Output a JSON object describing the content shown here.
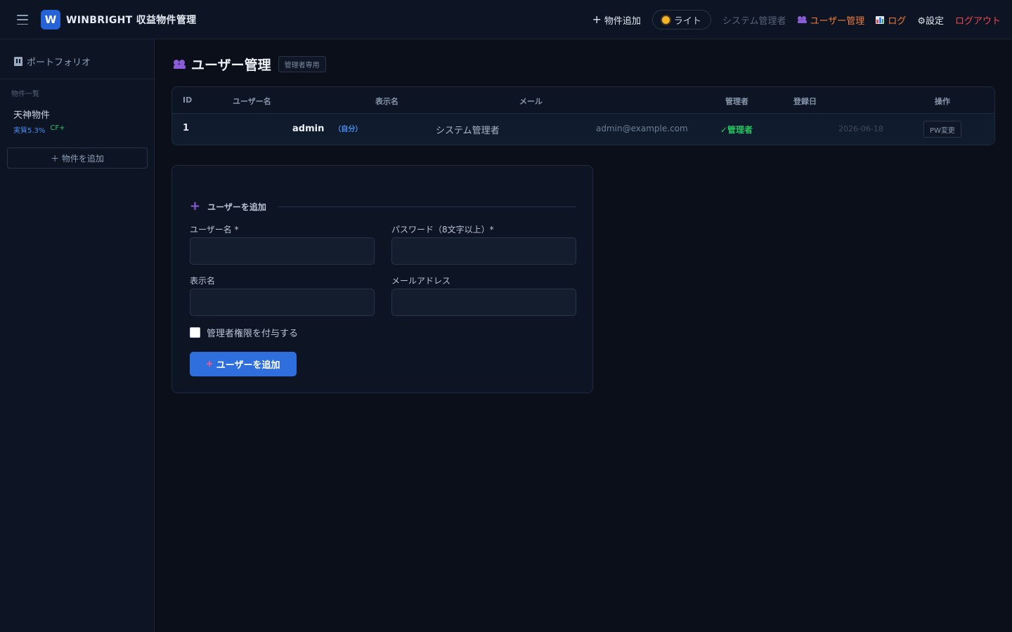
{
  "header": {
    "logo_letter": "W",
    "app_title": "WINBRIGHT 収益物件管理",
    "add_property": "物件追加",
    "add_property_icon": "plus-icon",
    "theme_label": "ライト",
    "theme_icon": "sun-icon",
    "current_user": "システム管理者",
    "user_management": "ユーザー管理",
    "logs": "ログ",
    "settings": "⚙設定",
    "logout": "ログアウト",
    "colors": {
      "accent": "#2563d6",
      "orange": "#f07d3a",
      "logout": "#f0474f"
    }
  },
  "sidebar": {
    "portfolio": "ポートフォリオ",
    "section_title": "物件一覧",
    "properties": [
      {
        "name": "天神物件",
        "yield": "実質5.3%",
        "cf": "CF+"
      }
    ],
    "add_button": "＋ 物件を追加"
  },
  "main": {
    "title": "ユーザー管理",
    "badge": "管理者専用",
    "table": {
      "columns": [
        "ID",
        "ユーザー名",
        "表示名",
        "メール",
        "管理者",
        "登録日",
        "操作"
      ],
      "rows": [
        {
          "id": "1",
          "username": "admin",
          "self_tag": "（自分）",
          "display_name": "システム管理者",
          "email": "admin@example.com",
          "admin": "✓管理者",
          "registered": "2026-06-18",
          "action": "PW変更"
        }
      ]
    },
    "form": {
      "heading": "ユーザーを追加",
      "username_label": "ユーザー名 *",
      "password_label": "パスワード（8文字以上）*",
      "display_name_label": "表示名",
      "email_label": "メールアドレス",
      "username_value": "",
      "password_value": "",
      "display_name_value": "",
      "email_value": "",
      "admin_checkbox_label": "管理者権限を付与する",
      "admin_checked": false,
      "submit": "ユーザーを追加"
    }
  }
}
